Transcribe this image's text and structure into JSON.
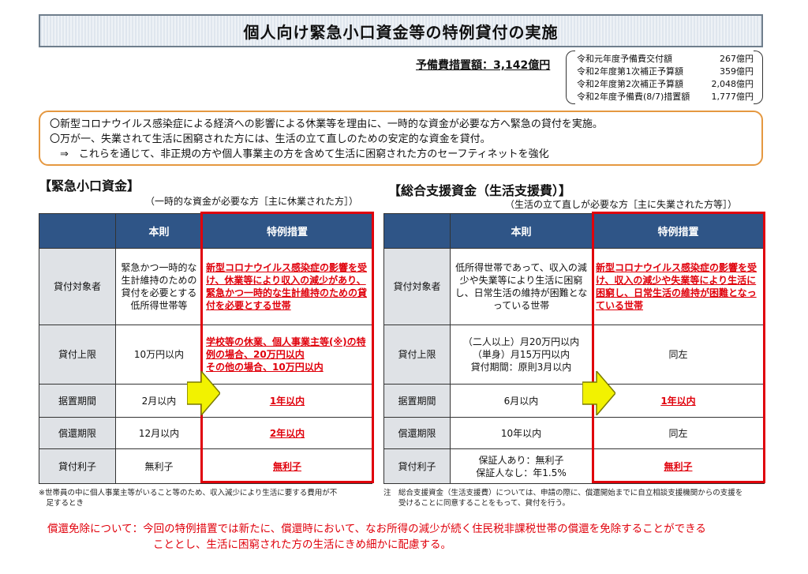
{
  "title": "個人向け緊急小口資金等の特例貸付の実施",
  "budget": {
    "label": "予備費措置額：3,142億円",
    "items": [
      {
        "name": "令和元年度予備費交付額",
        "amount": "267億円"
      },
      {
        "name": "令和2年度第1次補正予算額",
        "amount": "359億円"
      },
      {
        "name": "令和2年度第2次補正予算額",
        "amount": "2,048億円"
      },
      {
        "name": "令和2年度予備費(8/7)措置額",
        "amount": "1,777億円"
      }
    ]
  },
  "summary": [
    "〇新型コロナウイルス感染症による経済への影響による休業等を理由に、一時的な資金が必要な方へ緊急の貸付を実施。",
    "〇万が一、失業されて生活に困窮された方には、生活の立て直しのための安定的な資金を貸付。",
    "　⇒　これらを通じて、非正規の方や個人事業主の方を含めて生活に困窮された方のセーフティネットを強化"
  ],
  "left": {
    "title": "【緊急小口資金】",
    "subtitle": "（一時的な資金が必要な方［主に休業された方］）",
    "headers": [
      "",
      "本則",
      "特例措置"
    ],
    "rows": [
      {
        "label": "貸付対象者",
        "base": "緊急かつ一時的な生計維持のための貸付を必要とする低所得世帯等",
        "special": "新型コロナウイルス感染症の影響を受け、休業等により収入の減少があり、緊急かつ一時的な生計維持のための貸付を必要とする世帯"
      },
      {
        "label": "貸付上限",
        "base": "10万円以内",
        "special": "学校等の休業、個人事業主等(※)の特例の場合、20万円以内\nその他の場合、10万円以内"
      },
      {
        "label": "据置期間",
        "base": "2月以内",
        "special": "1年以内"
      },
      {
        "label": "償還期限",
        "base": "12月以内",
        "special": "2年以内"
      },
      {
        "label": "貸付利子",
        "base": "無利子",
        "special": "無利子"
      }
    ],
    "note": "※世帯員の中に個人事業主等がいること等のため、収入減少により生活に要する費用が不\n　足するとき"
  },
  "right": {
    "title": "【総合支援資金（生活支援費）】",
    "subtitle": "（生活の立て直しが必要な方［主に失業された方等］）",
    "headers": [
      "",
      "本則",
      "特例措置"
    ],
    "rows": [
      {
        "label": "貸付対象者",
        "base": "低所得世帯であって、収入の減少や失業等により生活に困窮し、日常生活の維持が困難となっている世帯",
        "special": "新型コロナウイルス感染症の影響を受け、収入の減少や失業等により生活に困窮し、日常生活の維持が困難となっている世帯"
      },
      {
        "label": "貸付上限",
        "base": "（二人以上）月20万円以内\n（単身）月15万円以内\n貸付期間：原則3月以内",
        "special": "同左"
      },
      {
        "label": "据置期間",
        "base": "6月以内",
        "special": "1年以内"
      },
      {
        "label": "償還期限",
        "base": "10年以内",
        "special": "同左"
      },
      {
        "label": "貸付利子",
        "base": "保証人あり：無利子\n保証人なし：年1.5%",
        "special": "無利子"
      }
    ],
    "note": "注　総合支援資金（生活支援費）については、申請の際に、償還開始までに自立相談支援機関からの支援を\n　　受けることに同意することをもって、貸付を行う。"
  },
  "bottom": {
    "line1": "償還免除について：今回の特例措置では新たに、償還時において、なお所得の減少が続く住民税非課税世帯の償還を免除することができる",
    "line2": "こととし、生活に困窮された方の生活にきめ細かに配慮する。"
  },
  "colors": {
    "header": "#2f5587",
    "accent": "#e0000b",
    "summary_border": "#e59840",
    "arrow": "#f2f200"
  }
}
